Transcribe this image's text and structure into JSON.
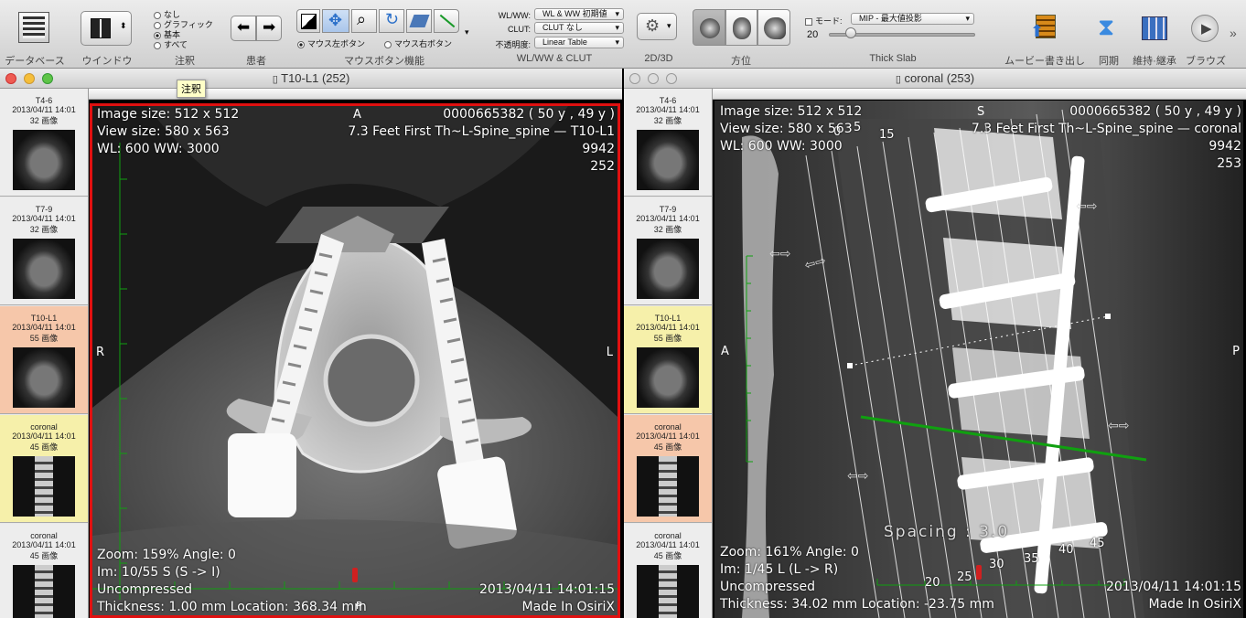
{
  "toolbar": {
    "groups": [
      {
        "label": "データベース"
      },
      {
        "label": "ウインドウ"
      },
      {
        "label": "注釈"
      },
      {
        "label": "患者"
      },
      {
        "label": "マウスボタン機能"
      },
      {
        "label": "WL/WW & CLUT"
      },
      {
        "label": "2D/3D"
      },
      {
        "label": "方位"
      },
      {
        "label": "Thick Slab"
      },
      {
        "label": "ムービー書き出し"
      },
      {
        "label": "同期"
      },
      {
        "label": "維持·継承"
      },
      {
        "label": "ブラウズ"
      }
    ],
    "annotation_options": [
      "なし",
      "グラフィック",
      "基本",
      "すべて"
    ],
    "annotation_selected": "基本",
    "mouse_left_label": "マウス左ボタン",
    "mouse_right_label": "マウス右ボタン",
    "wlww_label": "WL/WW:",
    "wlww_value": "WL & WW 初期値",
    "clut_label": "CLUT:",
    "clut_value": "CLUT なし",
    "opacity_label": "不透明度:",
    "opacity_value": "Linear Table",
    "mode_label": "モード:",
    "mode_value": "MIP - 最大値投影",
    "slab_value": "20",
    "tooltip": "注釈"
  },
  "left_window": {
    "title": "T10-L1 (252)",
    "thumbnails": [
      {
        "title": "T4-6",
        "date": "2013/04/11 14:01",
        "count": "32 画像",
        "state": "normal"
      },
      {
        "title": "T7-9",
        "date": "2013/04/11 14:01",
        "count": "32 画像",
        "state": "normal"
      },
      {
        "title": "T10-L1",
        "date": "2013/04/11 14:01",
        "count": "55 画像",
        "state": "active"
      },
      {
        "title": "coronal",
        "date": "2013/04/11 14:01",
        "count": "45 画像",
        "state": "other"
      },
      {
        "title": "coronal",
        "date": "2013/04/11 14:01",
        "count": "45 画像",
        "state": "normal"
      }
    ],
    "overlay": {
      "tl": [
        "Image size: 512 x 512",
        "View size: 580 x 563",
        "WL: 600 WW: 3000"
      ],
      "tr": [
        "0000665382 ( 50 y , 49 y )",
        "7.3 Feet First Th~L-Spine_spine — T10-L1",
        "9942",
        "252"
      ],
      "bl": [
        "Zoom: 159% Angle: 0",
        "Im: 10/55  S (S -> I)",
        "Uncompressed",
        "Thickness: 1.00 mm Location: 368.34 mm"
      ],
      "br": [
        "2013/04/11 14:01:15",
        "Made In OsiriX"
      ],
      "top": "A",
      "left": "R",
      "right": "L",
      "bottom": "P"
    }
  },
  "right_window": {
    "title": "coronal (253)",
    "thumbnails": [
      {
        "title": "T4-6",
        "date": "2013/04/11 14:01",
        "count": "32 画像",
        "state": "normal"
      },
      {
        "title": "T7-9",
        "date": "2013/04/11 14:01",
        "count": "32 画像",
        "state": "normal"
      },
      {
        "title": "T10-L1",
        "date": "2013/04/11 14:01",
        "count": "55 画像",
        "state": "other"
      },
      {
        "title": "coronal",
        "date": "2013/04/11 14:01",
        "count": "45 画像",
        "state": "active"
      },
      {
        "title": "coronal",
        "date": "2013/04/11 14:01",
        "count": "45 画像",
        "state": "normal"
      }
    ],
    "overlay": {
      "tl": [
        "Image size: 512 x 512",
        "View size: 580 x 563",
        "WL: 600 WW: 3000"
      ],
      "tr": [
        "0000665382 ( 50 y , 49 y )",
        "7.3 Feet First Th~L-Spine_spine — coronal",
        "9942",
        "253"
      ],
      "bl": [
        "Zoom: 161% Angle: 0",
        "Im: 1/45  L (L -> R)",
        "Uncompressed",
        "Thickness: 34.02 mm Location: -23.75 mm"
      ],
      "br": [
        "2013/04/11 14:01:15",
        "Made In OsiriX"
      ],
      "top": "S",
      "left": "A",
      "right": "P"
    },
    "slice_numbers": [
      "0",
      "5",
      "15",
      "20",
      "25",
      "30",
      "35",
      "40",
      "45"
    ],
    "spacing_label": "Spacing : 3.0"
  },
  "colors": {
    "active_border": "#e01010",
    "crossline": "#10a010",
    "active_thumb": "#f6c7aa",
    "other_thumb": "#f6f0aa"
  }
}
